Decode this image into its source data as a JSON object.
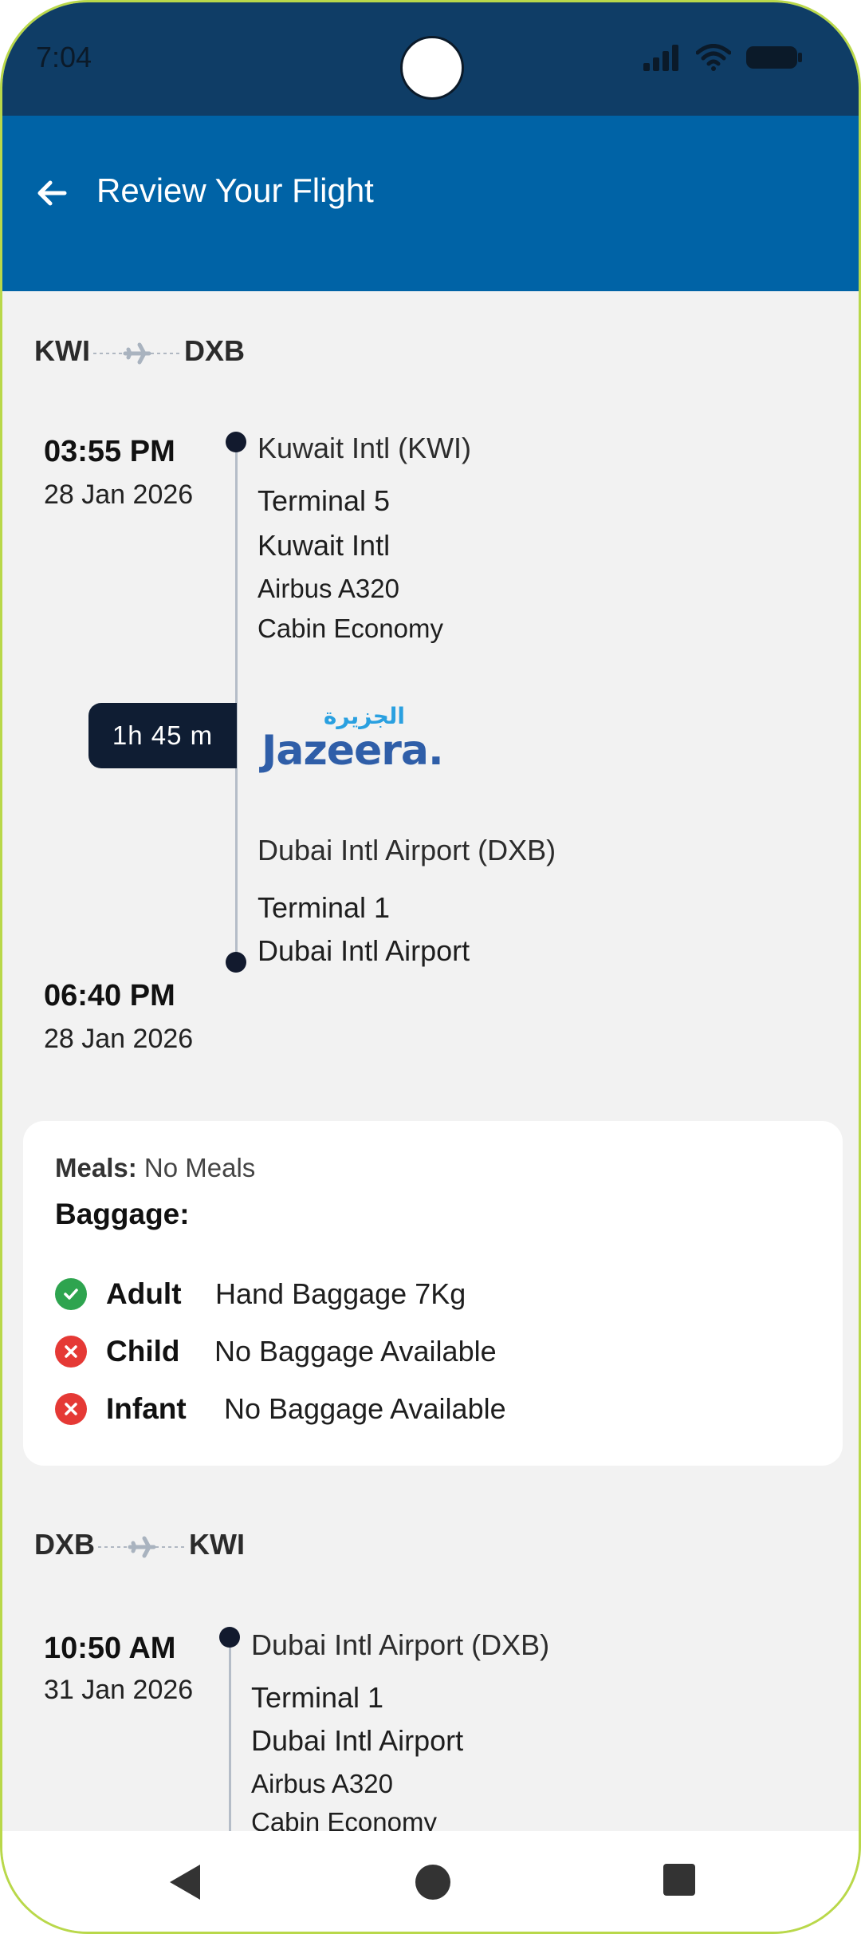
{
  "status": {
    "time": "7:04"
  },
  "appbar": {
    "title": "Review Your Flight",
    "back_icon": "arrow-left-icon"
  },
  "outbound": {
    "from_code": "KWI",
    "to_code": "DXB",
    "departure_time": "03:55 PM",
    "departure_date": "28 Jan 2026",
    "departure_airport": "Kuwait Intl (KWI)",
    "departure_terminal": "Terminal 5",
    "departure_airport_name": "Kuwait Intl",
    "aircraft": "Airbus A320",
    "cabin": "Cabin Economy",
    "duration": "1h 45 m",
    "airline_logo_text": "Jazeera.",
    "airline_logo_arabic": "الجزيرة",
    "arrival_airport": "Dubai Intl Airport (DXB)",
    "arrival_terminal": "Terminal 1",
    "arrival_airport_name": "Dubai Intl Airport",
    "arrival_time": "06:40 PM",
    "arrival_date": "28 Jan 2026"
  },
  "extras": {
    "meals_label": "Meals:",
    "meals_value": "No Meals",
    "baggage_title": "Baggage:",
    "rows": [
      {
        "type": "Adult",
        "desc": "Hand Baggage  7Kg",
        "status": "included",
        "icon": "check-circle-icon"
      },
      {
        "type": "Child",
        "desc": "No Baggage Available",
        "status": "none",
        "icon": "x-circle-icon"
      },
      {
        "type": "Infant",
        "desc": "No Baggage Available",
        "status": "none",
        "icon": "x-circle-icon"
      }
    ]
  },
  "return": {
    "from_code": "DXB",
    "to_code": "KWI",
    "departure_time": "10:50 AM",
    "departure_date": "31 Jan 2026",
    "departure_airport": "Dubai Intl Airport (DXB)",
    "departure_terminal": "Terminal 1",
    "departure_airport_name": "Dubai Intl Airport",
    "aircraft": "Airbus A320",
    "cabin": "Cabin Economy"
  },
  "colors": {
    "header": "#0063a6",
    "status_bar": "#0f3d66",
    "included": "#2ea44f",
    "none": "#e53935",
    "badge": "#0f1d33"
  }
}
